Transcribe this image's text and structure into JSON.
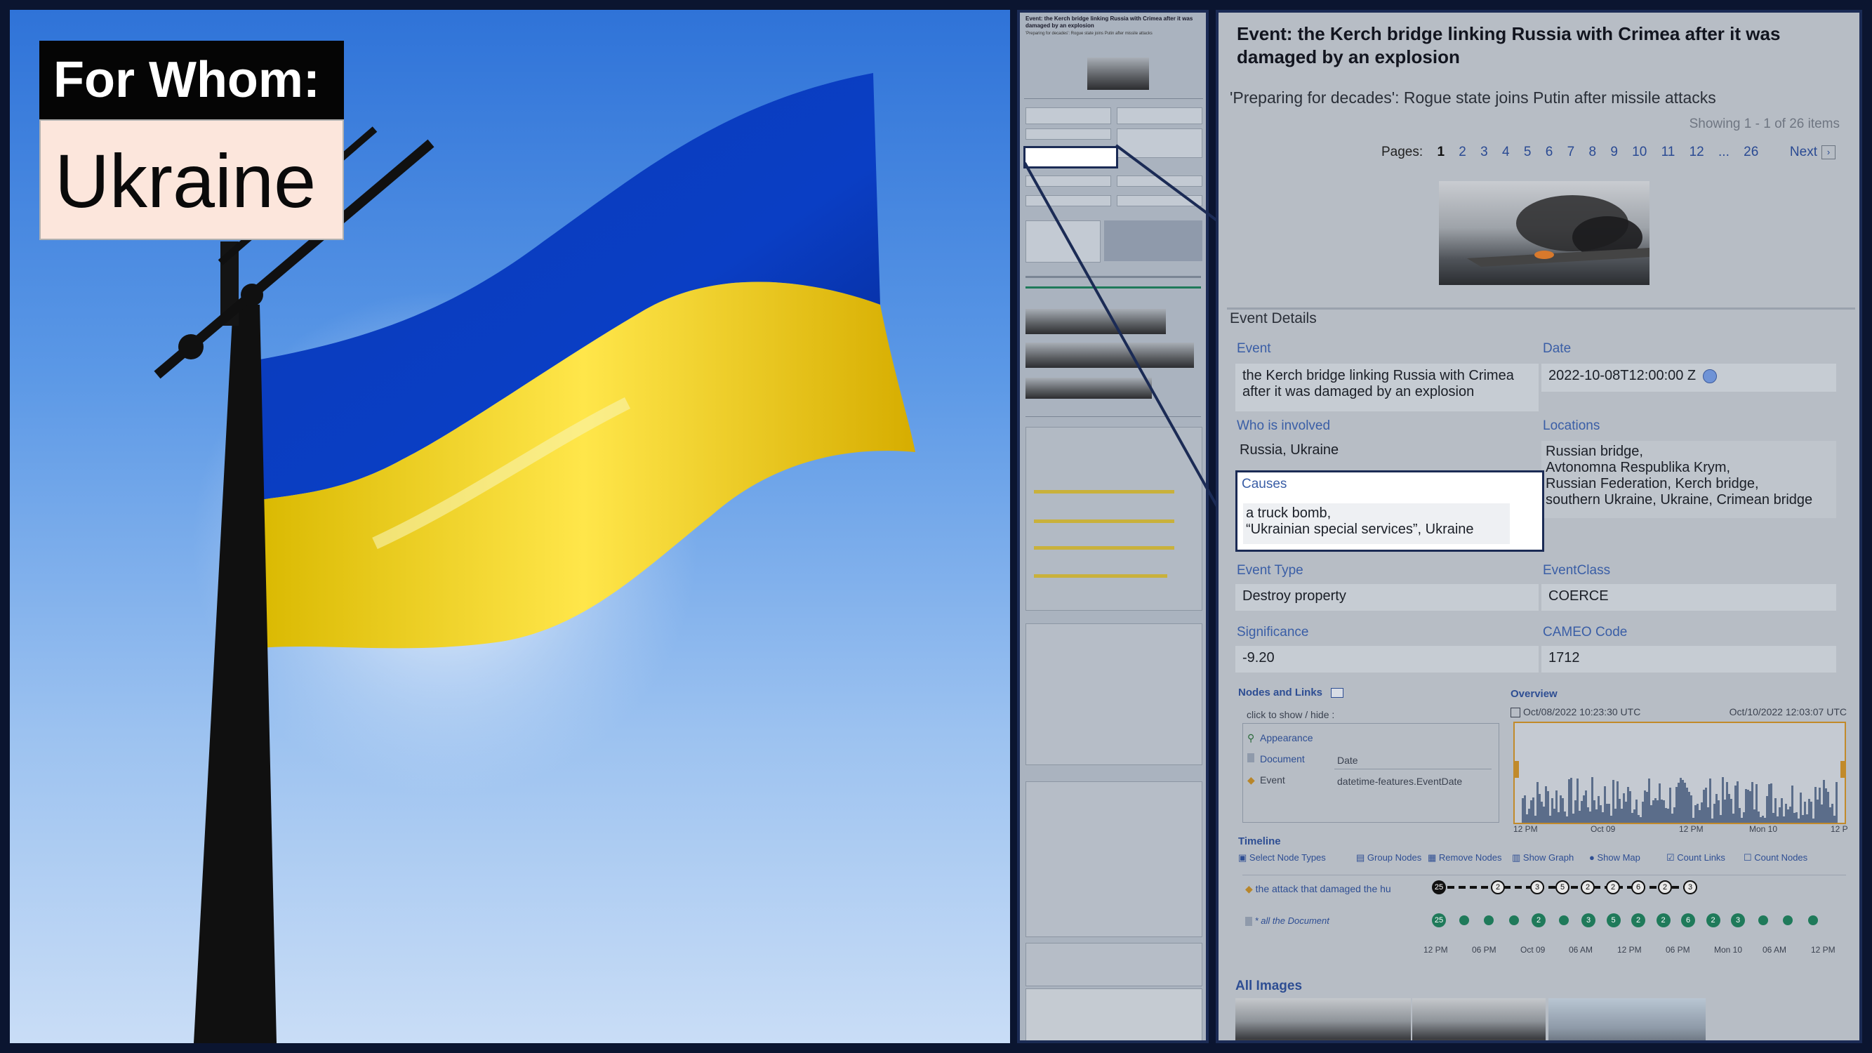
{
  "card": {
    "heading": "For Whom:",
    "value": "Ukraine"
  },
  "page": {
    "title": "Event: the Kerch bridge linking Russia with Crimea after it was damaged by an explosion",
    "subtitle": "'Preparing for decades': Rogue state joins Putin after missile attacks",
    "showing": "Showing 1 - 1 of 26 items",
    "pages_label": "Pages:",
    "pages": [
      "1",
      "2",
      "3",
      "4",
      "5",
      "6",
      "7",
      "8",
      "9",
      "10",
      "11",
      "12",
      "...",
      "26"
    ],
    "current_page": "1",
    "next_label": "Next",
    "next_icon": "chevron-right"
  },
  "event_details": {
    "section_title": "Event Details",
    "event_label": "Event",
    "event_value_line1": "the Kerch bridge linking Russia with Crimea",
    "event_value_line2": "after it was damaged by an explosion",
    "date_label": "Date",
    "date_value": "2022-10-08T12:00:00 Z",
    "who_label": "Who is involved",
    "who_value": "Russia, Ukraine",
    "locations_label": "Locations",
    "locations_lines": [
      "Russian bridge,",
      "Avtonomna Respublika Krym,",
      "Russian Federation, Kerch bridge,",
      "southern Ukraine, Ukraine, Crimean bridge"
    ],
    "causes_label": "Causes",
    "causes_line1": "a truck bomb,",
    "causes_line2": "“Ukrainian special services”, Ukraine",
    "event_type_label": "Event Type",
    "event_type_value": "Destroy property",
    "event_class_label": "EventClass",
    "event_class_value": "COERCE",
    "significance_label": "Significance",
    "significance_value": "-9.20",
    "cameo_label": "CAMEO Code",
    "cameo_value": "1712"
  },
  "nodes_links": {
    "title": "Nodes and Links",
    "hint": "click to show / hide :",
    "rows": [
      {
        "label": "Appearance",
        "value": ""
      },
      {
        "label": "Document",
        "value": "Date"
      },
      {
        "label": "Event",
        "value": "datetime-features.EventDate"
      }
    ]
  },
  "overview": {
    "title": "Overview",
    "start": "Oct/08/2022 10:23:30 UTC",
    "end": "Oct/10/2022 12:03:07 UTC",
    "ticks": [
      "12 PM",
      "Oct 09",
      "12 PM",
      "Mon 10",
      "12 P"
    ]
  },
  "timeline": {
    "title": "Timeline",
    "toolbar": [
      "Select Node Types",
      "Group Nodes",
      "Remove Nodes",
      "Show Graph",
      "Show Map",
      "Count Links",
      "Count Nodes"
    ],
    "row1_label": "the attack that damaged the hu",
    "row2_label": "* all the Document",
    "row1_nodes": [
      "25",
      "2",
      "3",
      "5",
      "2",
      "2",
      "6",
      "2",
      "3"
    ],
    "row2_nodes": [
      "25",
      "",
      "",
      "",
      "2",
      "",
      "3",
      "5",
      "2",
      "2",
      "6",
      "2",
      "3",
      "",
      "",
      ""
    ],
    "ticks": [
      "12 PM",
      "06 PM",
      "Oct 09",
      "06 AM",
      "12 PM",
      "06 PM",
      "Mon 10",
      "06 AM",
      "12 PM"
    ]
  },
  "all_images": {
    "title": "All Images"
  },
  "colors": {
    "frame": "#1b2b55",
    "flag_blue": "#0a3ec4",
    "flag_yellow": "#f5d000",
    "link": "#2a4a93",
    "label": "#3a5ea6"
  }
}
